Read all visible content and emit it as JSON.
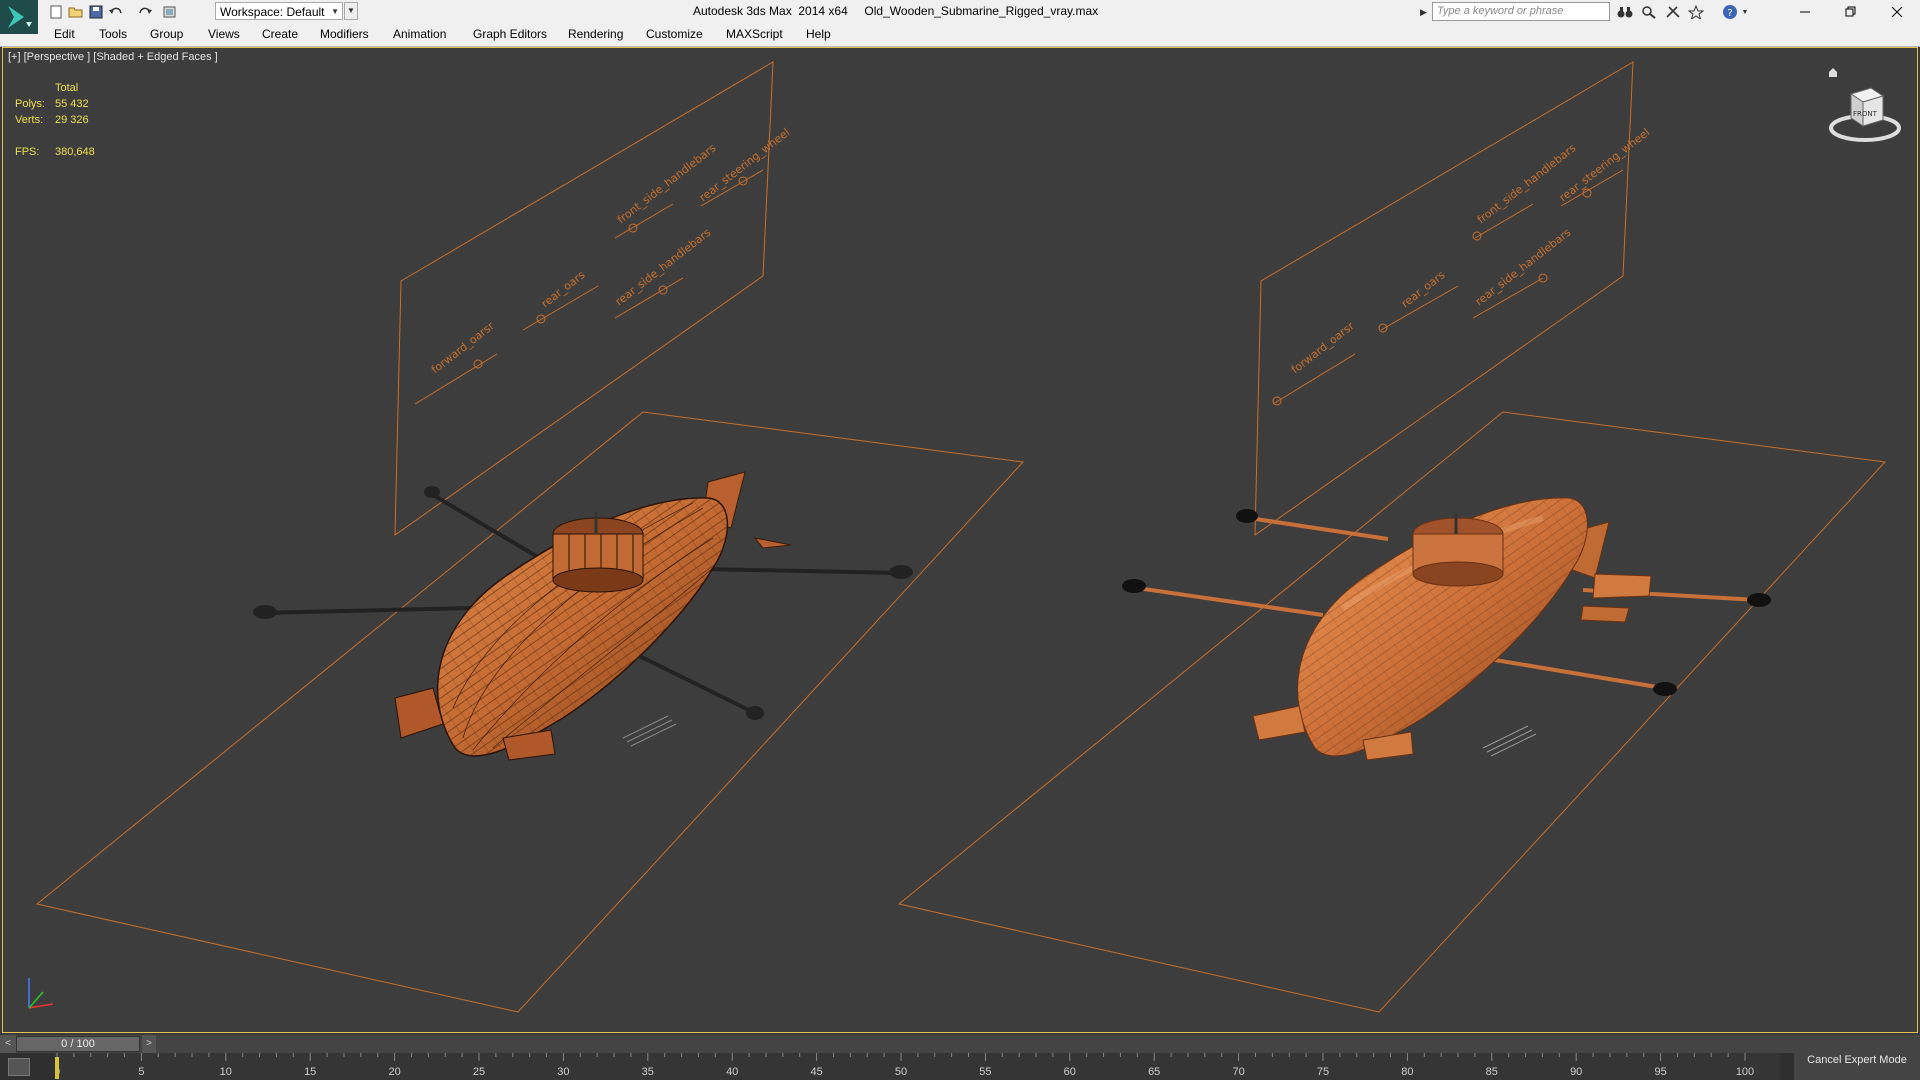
{
  "titlebar": {
    "workspace": "Workspace: Default",
    "title": "Autodesk 3ds Max  2014 x64     Old_Wooden_Submarine_Rigged_vray.max",
    "search_placeholder": "Type a keyword or phrase"
  },
  "menu": {
    "items": [
      "Edit",
      "Tools",
      "Group",
      "Views",
      "Create",
      "Modifiers",
      "Animation",
      "Graph Editors",
      "Rendering",
      "Customize",
      "MAXScript",
      "Help"
    ]
  },
  "viewport": {
    "label": "[+] [Perspective ] [Shaded + Edged Faces ]",
    "stats": {
      "header": "Total",
      "polys_label": "Polys:",
      "polys": "55 432",
      "verts_label": "Verts:",
      "verts": "29 326",
      "fps_label": "FPS:",
      "fps": "380,648"
    },
    "viewcube_face": "FRONT",
    "controls": [
      "forward_oarsr",
      "rear_oars",
      "rear_side_handlebars",
      "front_side_handlebars",
      "rear_steering_wheel"
    ]
  },
  "timeline": {
    "frame": "0 / 100",
    "ticks": [
      "0",
      "5",
      "10",
      "15",
      "20",
      "25",
      "30",
      "35",
      "40",
      "45",
      "50",
      "55",
      "60",
      "65",
      "70",
      "75",
      "80",
      "85",
      "90",
      "95",
      "100"
    ]
  },
  "status": {
    "cancel_expert": "Cancel Expert Mode"
  },
  "colors": {
    "viewport_bg": "#3d3d3d",
    "wire": "#d0772c",
    "wood": "#c9703a",
    "active_border": "#e0c34a",
    "stats_text": "#ece04a"
  }
}
